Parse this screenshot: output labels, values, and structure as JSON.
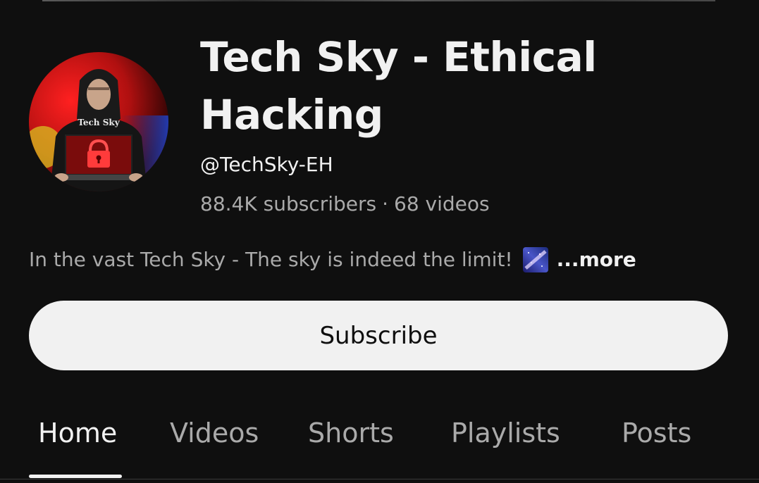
{
  "channel": {
    "title": "Tech Sky - Ethical Hacking",
    "handle": "@TechSky-EH",
    "subscribers": "88.4K subscribers",
    "stats_separator": "·",
    "videos": "68 videos",
    "description": "In the vast Tech Sky - The sky is indeed the limit!",
    "description_emoji": "milky-way-icon",
    "more_label": "...more",
    "avatar_text": "Tech Sky"
  },
  "subscribe": {
    "label": "Subscribe"
  },
  "tabs": [
    {
      "label": "Home",
      "active": true
    },
    {
      "label": "Videos",
      "active": false
    },
    {
      "label": "Shorts",
      "active": false
    },
    {
      "label": "Playlists",
      "active": false
    },
    {
      "label": "Posts",
      "active": false
    }
  ],
  "colors": {
    "background": "#0f0f0f",
    "primary_text": "#f1f1f1",
    "secondary_text": "#aaaaaa",
    "button_bg": "#f1f1f1",
    "button_text": "#0f0f0f"
  }
}
